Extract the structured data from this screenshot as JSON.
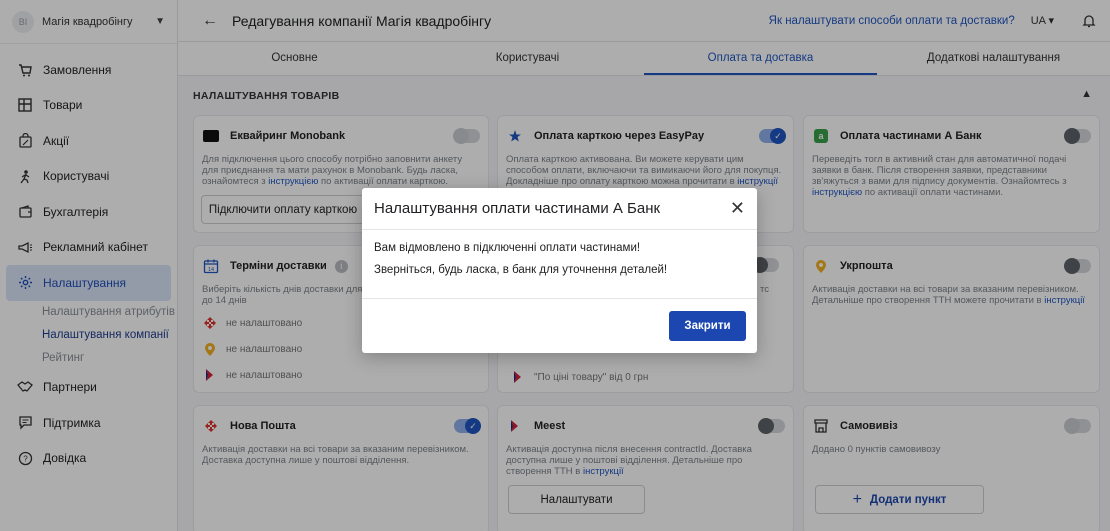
{
  "sidebar": {
    "company_logo": "ВІ",
    "company_name": "Магія квадробінгу",
    "items": [
      {
        "label": "Замовлення",
        "icon": "cart-icon"
      },
      {
        "label": "Товари",
        "icon": "grid-icon"
      },
      {
        "label": "Акції",
        "icon": "bag-percent-icon"
      },
      {
        "label": "Користувачі",
        "icon": "user-walk-icon"
      },
      {
        "label": "Бухгалтерія",
        "icon": "wallet-icon"
      },
      {
        "label": "Рекламний кабінет",
        "icon": "megaphone-icon"
      },
      {
        "label": "Налаштування",
        "icon": "gear-icon"
      },
      {
        "label": "Партнери",
        "icon": "handshake-icon"
      },
      {
        "label": "Підтримка",
        "icon": "chat-icon"
      },
      {
        "label": "Довідка",
        "icon": "help-icon"
      }
    ],
    "subitems": [
      "Налаштування атрибутів",
      "Налаштування компанії",
      "Рейтинг"
    ]
  },
  "header": {
    "title": "Редагування компанії Магія квадробінгу",
    "help_link": "Як налаштувати способи оплати та доставки?",
    "language": "UA"
  },
  "tabs": [
    "Основне",
    "Користувачі",
    "Оплата та доставка",
    "Додаткові налаштування"
  ],
  "section_title": "НАЛАШТУВАННЯ ТОВАРІВ",
  "cards": {
    "monobank": {
      "title": "Еквайринг Monobank",
      "desc": "Для підключення цього способу потрібно заповнити анкету для приєднання та мати рахунок в Monobank. Будь ласка, ознайомтеся з",
      "link": "інструкцією",
      "desc_tail": "по активації оплати карткою.",
      "button": "Підключити оплату карткою"
    },
    "easypay": {
      "title": "Оплата карткою через EasyPay",
      "desc": "Оплата карткою активована. Ви можете керувати цим способом оплати, включаючи та вимикаючи його для покупця. Докладніше про оплату карткою можна прочитати в",
      "link": "інструкції"
    },
    "abank": {
      "title": "Оплата частинами А Банк",
      "desc": "Переведіть тогл в активний стан для автоматичної подачі заявки в банк. Після створення заявки, представники зв'яжуться з вами для підпису документів. Ознайомтесь з",
      "link": "інструкцією",
      "desc_tail": "по активації оплати частинами."
    },
    "delivery_terms": {
      "title": "Терміни доставки",
      "desc": "Виберіть кількість днів доставки для",
      "desc2": "до 14 днів",
      "rows": [
        "не налаштовано",
        "не налаштовано",
        "не налаштовано"
      ]
    },
    "middle_partial": {
      "text_right": "тс",
      "price_text": "\"По ціні товару\" від 0 грн"
    },
    "ukrposhta": {
      "title": "Укрпошта",
      "desc": "Активація доставки на всі товари за вказаним перевізником. Детальніше про створення ТТН можете прочитати в",
      "link": "інструкції"
    },
    "novaposhta": {
      "title": "Нова Пошта",
      "desc": "Активація доставки на всі товари за вказаним перевізником. Доставка доступна лише у поштові відділення."
    },
    "meest": {
      "title": "Meest",
      "desc": "Активація доступна після внесення contractId. Доставка доступна лише у поштові відділення. Детальніше про створення ТТН в",
      "link": "інструкції",
      "button": "Налаштувати"
    },
    "pickup": {
      "title": "Самовивіз",
      "desc": "Додано 0 пунктів самовивозу",
      "button": "Додати пункт"
    }
  },
  "modal": {
    "title": "Налаштування оплати частинами А Банк",
    "line1": "Вам відмовлено в підключенні оплати частинами!",
    "line2": "Зверніться, будь ласка, в банк для уточнення деталей!",
    "button": "Закрити"
  },
  "colors": {
    "accent": "#1f56c2",
    "primary_button": "#1d47b0",
    "nova_red": "#e0332b",
    "ukrposhta_yellow": "#f2b01e",
    "meest_red": "#d6203c",
    "abank_green": "#3aa14a"
  }
}
